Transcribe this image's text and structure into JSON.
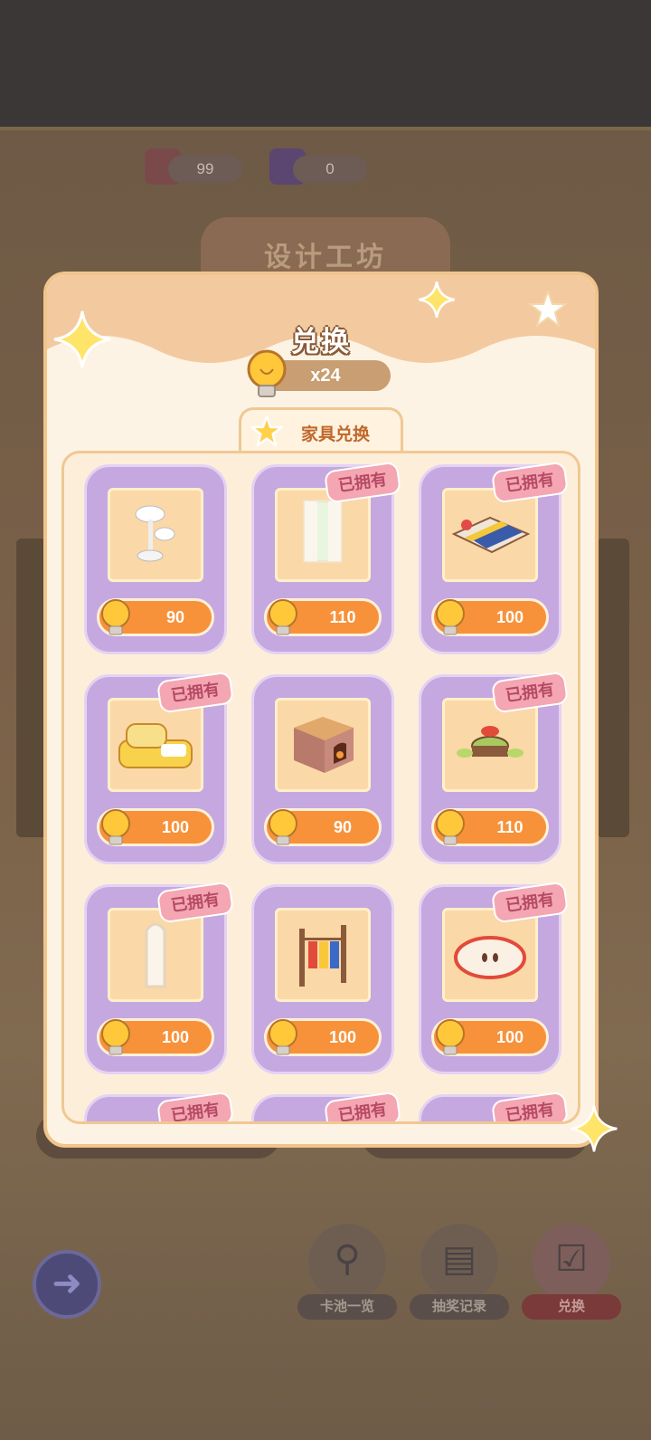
{
  "background": {
    "resources": [
      {
        "icon": "gem-icon",
        "value": "99"
      },
      {
        "icon": "ticket-card-icon",
        "value": "0"
      }
    ],
    "workshop_title": "设计工坊",
    "dock": [
      {
        "icon": "magnifier-icon",
        "label": "卡池一览"
      },
      {
        "icon": "record-search-icon",
        "label": "抽奖记录"
      },
      {
        "icon": "shopping-bag-icon",
        "label": "兑换",
        "active": true
      }
    ]
  },
  "modal": {
    "title": "兑换",
    "currency": {
      "icon": "lightbulb-icon",
      "amount": "x24"
    },
    "tab": {
      "icon": "star-icon",
      "label": "家具兑换"
    },
    "items": [
      {
        "name": "mushroom-lamp",
        "price": "90",
        "owned": false
      },
      {
        "name": "window-curtain",
        "price": "110",
        "owned": true
      },
      {
        "name": "bed",
        "price": "100",
        "owned": true
      },
      {
        "name": "bread-sofa",
        "price": "100",
        "owned": true
      },
      {
        "name": "fireplace",
        "price": "90",
        "owned": false
      },
      {
        "name": "stump-table",
        "price": "110",
        "owned": true
      },
      {
        "name": "floor-mirror",
        "price": "100",
        "owned": true
      },
      {
        "name": "wooden-shelf",
        "price": "100",
        "owned": false
      },
      {
        "name": "apple-rug",
        "price": "100",
        "owned": true
      },
      {
        "name": "partial-item-1",
        "price": "",
        "owned": true
      },
      {
        "name": "partial-item-2",
        "price": "",
        "owned": true
      },
      {
        "name": "partial-item-3",
        "price": "",
        "owned": true
      }
    ],
    "owned_label": "已拥有"
  },
  "colors": {
    "card_purple": "#c6a8e0",
    "price_orange": "#f7923a",
    "owned_pink": "#f4a6b2",
    "modal_cream": "#fdf3e4"
  }
}
